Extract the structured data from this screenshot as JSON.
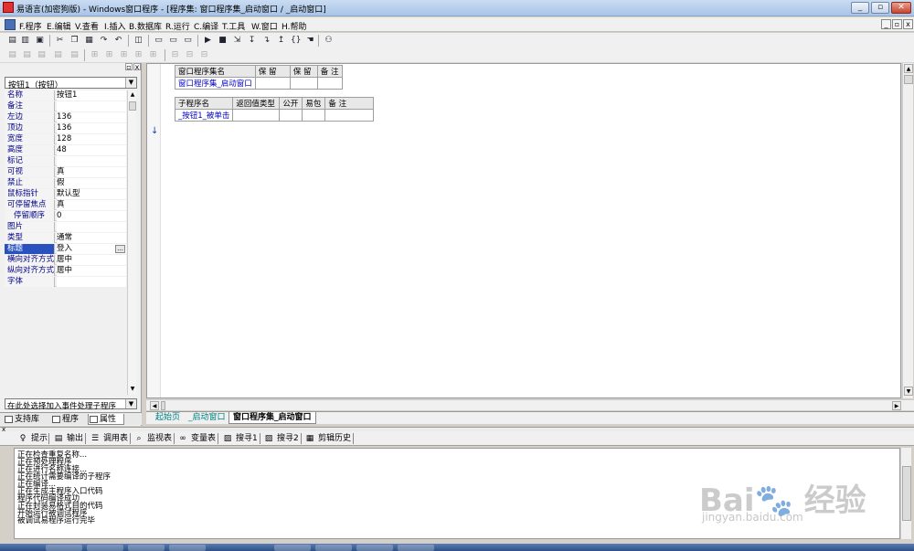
{
  "window": {
    "title": "易语言(加密狗版) - Windows窗口程序 - [程序集: 窗口程序集_启动窗口 / _启动窗口]",
    "minimize": "_",
    "maximize": "▫",
    "close": "✕"
  },
  "menu": {
    "items": [
      "F.程序",
      "E.编辑",
      "V.查看",
      "I.插入",
      "B.数据库",
      "R.运行",
      "C.编译",
      "T.工具",
      "W.窗口",
      "H.帮助"
    ],
    "mdi_min": "_",
    "mdi_restore": "▫",
    "mdi_close": "x"
  },
  "left_panel": {
    "selector_value": "按钮1（按钮）",
    "properties": [
      {
        "key": "名称",
        "value": "按钮1"
      },
      {
        "key": "备注",
        "value": ""
      },
      {
        "key": "左边",
        "value": "136"
      },
      {
        "key": "顶边",
        "value": "136"
      },
      {
        "key": "宽度",
        "value": "128"
      },
      {
        "key": "高度",
        "value": "48"
      },
      {
        "key": "标记",
        "value": ""
      },
      {
        "key": "可视",
        "value": "真"
      },
      {
        "key": "禁止",
        "value": "假"
      },
      {
        "key": "鼠标指针",
        "value": "默认型"
      },
      {
        "key": "可停留焦点",
        "value": "真"
      },
      {
        "key": "停留顺序",
        "value": "0"
      },
      {
        "key": "图片",
        "value": ""
      },
      {
        "key": "类型",
        "value": "通常"
      },
      {
        "key": "标题",
        "value": "登入"
      },
      {
        "key": "横向对齐方式",
        "value": "居中"
      },
      {
        "key": "纵向对齐方式",
        "value": "居中"
      },
      {
        "key": "字体",
        "value": ""
      }
    ],
    "event_selector": "在此处选择加入事件处理子程序",
    "tabs": [
      "支持库",
      "程序",
      "属性"
    ]
  },
  "editor": {
    "assembly_table": {
      "headers": [
        "窗口程序集名",
        "保 留",
        "保 留",
        "备 注"
      ],
      "row": [
        "窗口程序集_启动窗口",
        "",
        "",
        ""
      ]
    },
    "sub_table": {
      "headers": [
        "子程序名",
        "返回值类型",
        "公开",
        "易包",
        "备 注"
      ],
      "row": [
        "_按钮1_被单击",
        "",
        "",
        "",
        ""
      ]
    },
    "doc_tabs": [
      "起始页",
      "_启动窗口",
      "窗口程序集_启动窗口"
    ]
  },
  "output": {
    "tabs": [
      "提示",
      "输出",
      "调用表",
      "监视表",
      "变量表",
      "搜寻1",
      "搜寻2",
      "剪辑历史"
    ],
    "lines": [
      "正在检查重复名称...",
      "正在预处理程序",
      "正在进行名称连接...",
      "正在统计需要编译的子程序",
      "正在编译...",
      "正在生成主程序入口代码",
      "程序代码编译成功",
      "正在封装易格式目的代码",
      "开始运行被调试程序",
      "被调试易程序运行完毕"
    ]
  },
  "watermark": {
    "brand": "Bai",
    "brand_cn": "经验",
    "url": "jingyan.baidu.com"
  }
}
